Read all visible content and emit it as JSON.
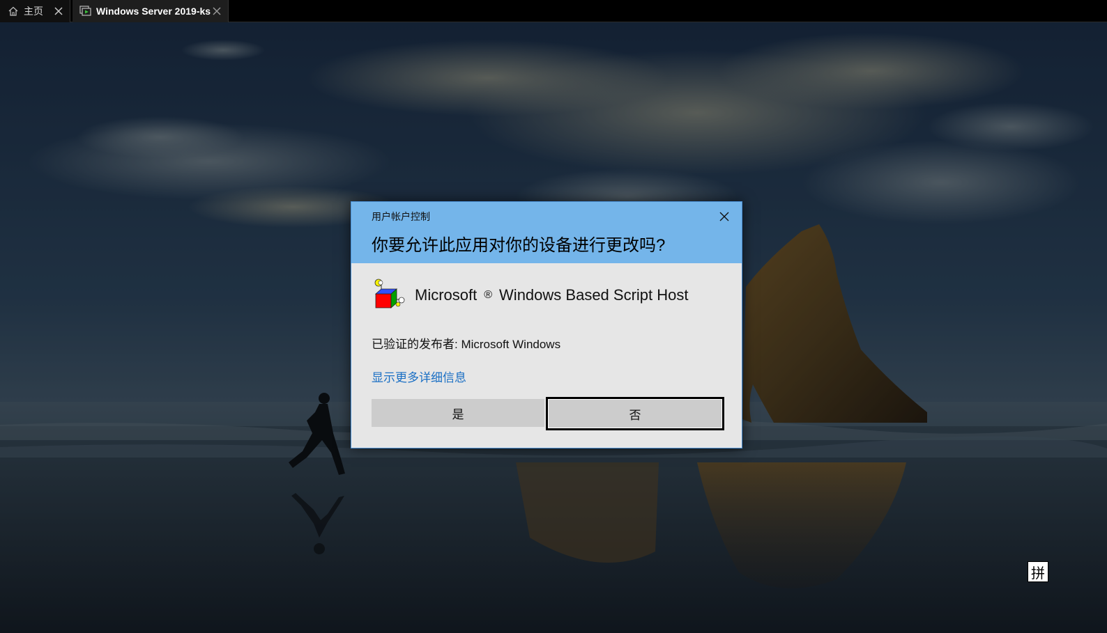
{
  "tabs": [
    {
      "label": "主页",
      "icon": "home-icon",
      "active": false
    },
    {
      "label": "Windows Server 2019-ks",
      "icon": "vm-icon",
      "active": true
    }
  ],
  "uac": {
    "caption": "用户帐户控制",
    "question": "你要允许此应用对你的设备进行更改吗?",
    "app_name_prefix": "Microsoft",
    "app_name_registered": "®",
    "app_name_suffix": "Windows Based Script Host",
    "app_icon": "script-host-icon",
    "publisher": "已验证的发布者: Microsoft Windows",
    "more_details_link": "显示更多详细信息",
    "yes_label": "是",
    "no_label": "否"
  },
  "ime_indicator": "拼",
  "colors": {
    "header_blue": "#74b5ea",
    "link_blue": "#1a6fc4",
    "dialog_body": "#e6e6e6"
  }
}
